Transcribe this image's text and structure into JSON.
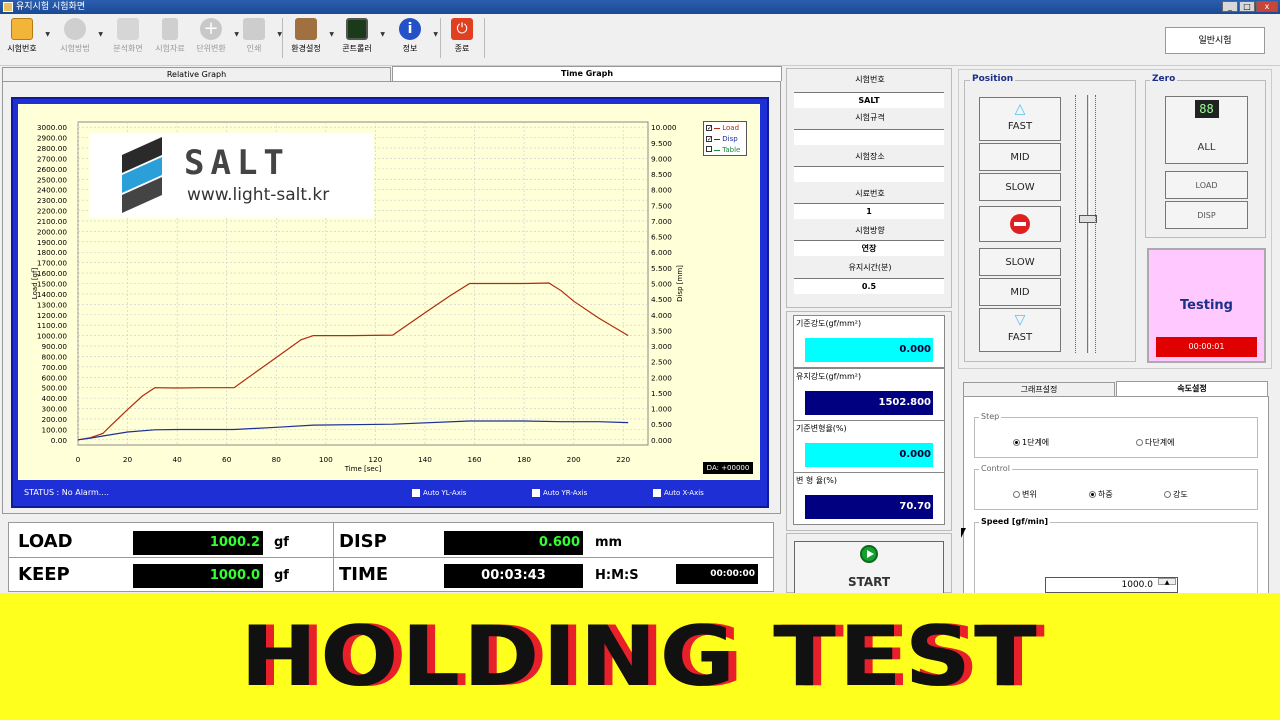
{
  "window": {
    "title": "유지시험 시험화면",
    "btn_min": "_",
    "btn_max": "□",
    "btn_close": "x"
  },
  "toolbar": {
    "items": [
      {
        "label": "시험번호",
        "icon": "key-icon",
        "enabled": true
      },
      {
        "label": "시험방법",
        "icon": "method-icon",
        "enabled": false
      },
      {
        "label": "분석화면",
        "icon": "analysis-icon",
        "enabled": false
      },
      {
        "label": "시험자료",
        "icon": "data-icon",
        "enabled": false
      },
      {
        "label": "단위변환",
        "icon": "plus-icon",
        "enabled": false
      },
      {
        "label": "인쇄",
        "icon": "printer-icon",
        "enabled": false
      },
      {
        "label": "환경설정",
        "icon": "settings-icon",
        "enabled": true
      },
      {
        "label": "콘트롤러",
        "icon": "controller-icon",
        "enabled": true
      },
      {
        "label": "정보",
        "icon": "info-icon",
        "enabled": true
      },
      {
        "label": "종료",
        "icon": "power-icon",
        "enabled": true
      }
    ],
    "mode": "일반시험"
  },
  "graph_tabs": [
    "Relative Graph",
    "Time Graph"
  ],
  "logo": {
    "brand": "SALT",
    "url": "www.light-salt.kr"
  },
  "legend": [
    {
      "label": "Load",
      "checked": true,
      "color": "#b22a10"
    },
    {
      "label": "Disp",
      "checked": true,
      "color": "#1c2f9a"
    },
    {
      "label": "Table",
      "checked": false,
      "color": "#1a8a3a"
    }
  ],
  "da": "DA: +00000",
  "status": "STATUS : No Alarm....",
  "auto_axes": [
    "Auto YL-Axis",
    "Auto YR-Axis",
    "Auto X-Axis"
  ],
  "chart_data": {
    "type": "line",
    "xlabel": "Time [sec]",
    "ylabel": "Load [gf]",
    "y2label": "Disp [mm]",
    "xlim": [
      0,
      230
    ],
    "ylim": [
      -50,
      3050
    ],
    "y2lim": [
      -0.1667,
      10.1667
    ],
    "x_ticks": [
      0,
      20,
      40,
      60,
      80,
      100,
      120,
      140,
      160,
      180,
      200,
      220
    ],
    "y_ticks": [
      "0.00",
      "100.00",
      "200.00",
      "300.00",
      "400.00",
      "500.00",
      "600.00",
      "700.00",
      "800.00",
      "900.00",
      "1000.00",
      "1100.00",
      "1200.00",
      "1300.00",
      "1400.00",
      "1500.00",
      "1600.00",
      "1700.00",
      "1800.00",
      "1900.00",
      "2000.00",
      "2100.00",
      "2200.00",
      "2300.00",
      "2400.00",
      "2500.00",
      "2600.00",
      "2700.00",
      "2800.00",
      "2900.00",
      "3000.00"
    ],
    "y2_ticks": [
      "0.000",
      "0.500",
      "1.000",
      "1.500",
      "2.000",
      "2.500",
      "3.000",
      "3.500",
      "4.000",
      "4.500",
      "5.000",
      "5.500",
      "6.000",
      "6.500",
      "7.000",
      "7.500",
      "8.000",
      "8.500",
      "9.000",
      "9.500",
      "10.000"
    ],
    "grid": true,
    "series": [
      {
        "name": "Load",
        "axis": "left",
        "color": "#b22a10",
        "x": [
          0,
          5,
          10,
          13,
          20,
          26,
          31,
          40,
          50,
          63,
          70,
          80,
          90,
          95,
          110,
          127,
          140,
          150,
          158,
          170,
          180,
          190,
          195,
          200,
          210,
          222
        ],
        "y": [
          0,
          20,
          60,
          130,
          290,
          420,
          500,
          497,
          500,
          500,
          620,
          790,
          960,
          1000,
          1000,
          1005,
          1220,
          1380,
          1500,
          1500,
          1500,
          1505,
          1430,
          1330,
          1170,
          1000
        ]
      },
      {
        "name": "Disp",
        "axis": "right",
        "color": "#1c2f9a",
        "x": [
          0,
          5,
          10,
          20,
          31,
          40,
          63,
          80,
          95,
          127,
          158,
          180,
          195,
          210,
          222
        ],
        "y": [
          0.0,
          0.05,
          0.12,
          0.25,
          0.32,
          0.33,
          0.33,
          0.4,
          0.47,
          0.5,
          0.6,
          0.6,
          0.58,
          0.58,
          0.55
        ]
      }
    ]
  },
  "readout": {
    "load_label": "LOAD",
    "load_value": "1000.2",
    "load_unit": "gf",
    "disp_label": "DISP",
    "disp_value": "0.600",
    "disp_unit": "mm",
    "keep_label": "KEEP",
    "keep_value": "1000.0",
    "keep_unit": "gf",
    "time_label": "TIME",
    "time_value": "00:03:43",
    "time_unit": "H:M:S",
    "time2_value": "00:00:00"
  },
  "info": {
    "test_no_label": "시험번호",
    "test_no": "SALT",
    "standard_label": "시험규격",
    "standard": "",
    "place_label": "시험장소",
    "place": "",
    "sample_label": "시료번호",
    "sample": "1",
    "direction_label": "시험방향",
    "direction": "연장",
    "hold_time_label": "유지시간(분)",
    "hold_time": "0.5"
  },
  "strength": {
    "base_strength_label": "기준강도(gf/mm²)",
    "base_strength": "0.000",
    "hold_strength_label": "유지강도(gf/mm²)",
    "hold_strength": "1502.800",
    "base_ratio_label": "기준변형율(%)",
    "base_ratio": "0.000",
    "ratio_label": "변 형 율(%)",
    "ratio": "70.70"
  },
  "start_label": "START",
  "position": {
    "title": "Position",
    "up_fast": "FAST",
    "up_mid": "MID",
    "up_slow": "SLOW",
    "down_slow": "SLOW",
    "down_mid": "MID",
    "down_fast": "FAST"
  },
  "zero": {
    "title": "Zero",
    "display": "88",
    "all": "ALL",
    "load": "LOAD",
    "disp": "DISP"
  },
  "testing": {
    "label": "Testing",
    "time": "00:00:01"
  },
  "settings_tabs": [
    "그래프설정",
    "속도설정"
  ],
  "step": {
    "title": "Step",
    "opt1": "1단계에",
    "opt2": "다단계에",
    "selected": "opt1"
  },
  "control": {
    "title": "Control",
    "opt1": "변위",
    "opt2": "하중",
    "opt3": "강도",
    "selected": "opt2"
  },
  "speed": {
    "title": "Speed [gf/min]",
    "value": "1000.0"
  },
  "banner": {
    "text": "HOLDING TEST"
  }
}
